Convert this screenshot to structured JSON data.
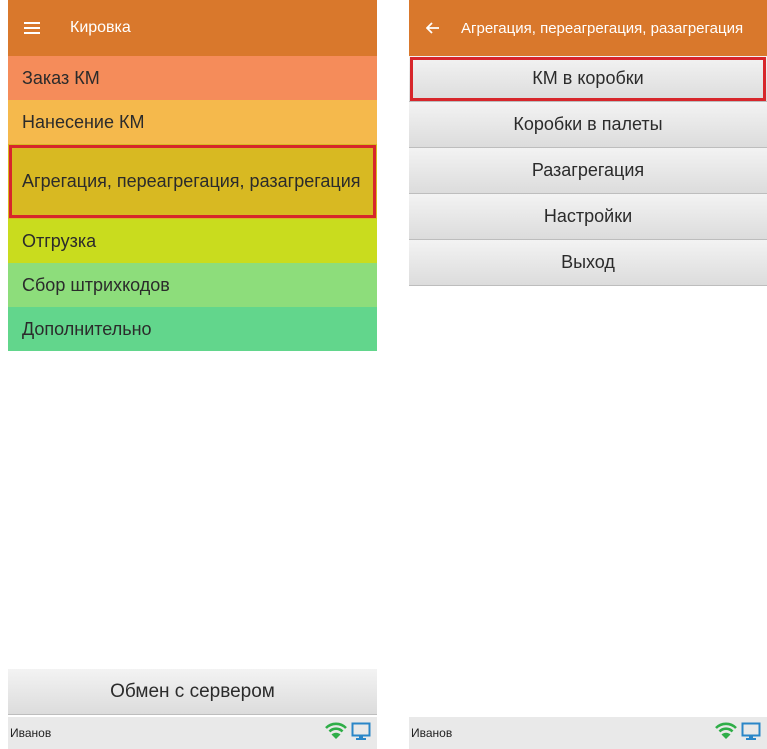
{
  "left_screen": {
    "title": "Кировка",
    "menu_icon": "hamburger-menu-icon",
    "items": [
      {
        "label": "Заказ КМ",
        "color": "#f58c5a"
      },
      {
        "label": "Нанесение КМ",
        "color": "#f5b94c"
      },
      {
        "label": "Агрегация, переагрегация, разагрегация",
        "color": "#d8b922",
        "highlighted": true
      },
      {
        "label": "Отгрузка",
        "color": "#c9dc1e"
      },
      {
        "label": "Сбор штрихкодов",
        "color": "#8ddd7b"
      },
      {
        "label": "Дополнительно",
        "color": "#62d68c"
      }
    ],
    "exchange_button": "Обмен с сервером",
    "status": {
      "user": "Иванов",
      "icons": [
        "wifi-icon",
        "monitor-icon"
      ]
    }
  },
  "right_screen": {
    "title": "Агрегация, переагрегация, разагрегация",
    "back_icon": "back-arrow-icon",
    "buttons": [
      {
        "label": "КМ в коробки",
        "highlighted": true
      },
      {
        "label": "Коробки в палеты"
      },
      {
        "label": "Разагрегация"
      },
      {
        "label": "Настройки"
      },
      {
        "label": "Выход"
      }
    ],
    "status": {
      "user": "Иванов",
      "icons": [
        "wifi-icon",
        "monitor-icon"
      ]
    }
  },
  "colors": {
    "appbar": "#d9782c",
    "highlight_border": "#d7262b",
    "wifi": "#2fae48",
    "monitor": "#2a86c8"
  }
}
